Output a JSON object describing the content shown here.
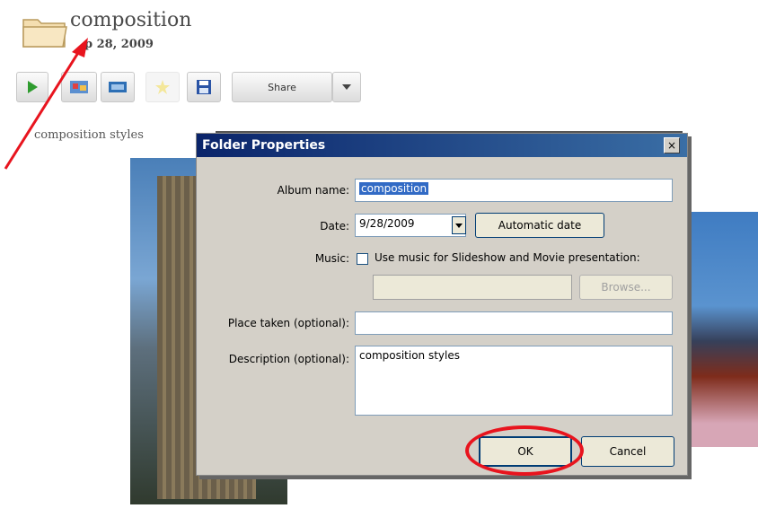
{
  "album": {
    "title": "composition",
    "date": "p 28, 2009",
    "caption": "composition styles"
  },
  "toolbar": {
    "share_label": "Share",
    "icons": [
      "play-slideshow-icon",
      "collage-icon",
      "movie-icon",
      "star-icon",
      "save-icon"
    ]
  },
  "dialog": {
    "title": "Folder Properties",
    "close_label": "×",
    "album_name_label": "Album name:",
    "album_name_value": "composition",
    "date_label": "Date:",
    "date_value": "9/28/2009",
    "automatic_date_label": "Automatic date",
    "music_label": "Music:",
    "music_checkbox_label": "Use music for Slideshow and Movie presentation:",
    "music_path_value": "",
    "browse_label": "Browse...",
    "place_label": "Place taken (optional):",
    "place_value": "",
    "description_label": "Description (optional):",
    "description_value": "composition styles",
    "ok_label": "OK",
    "cancel_label": "Cancel"
  },
  "annotation": {
    "color": "#e8141e"
  }
}
